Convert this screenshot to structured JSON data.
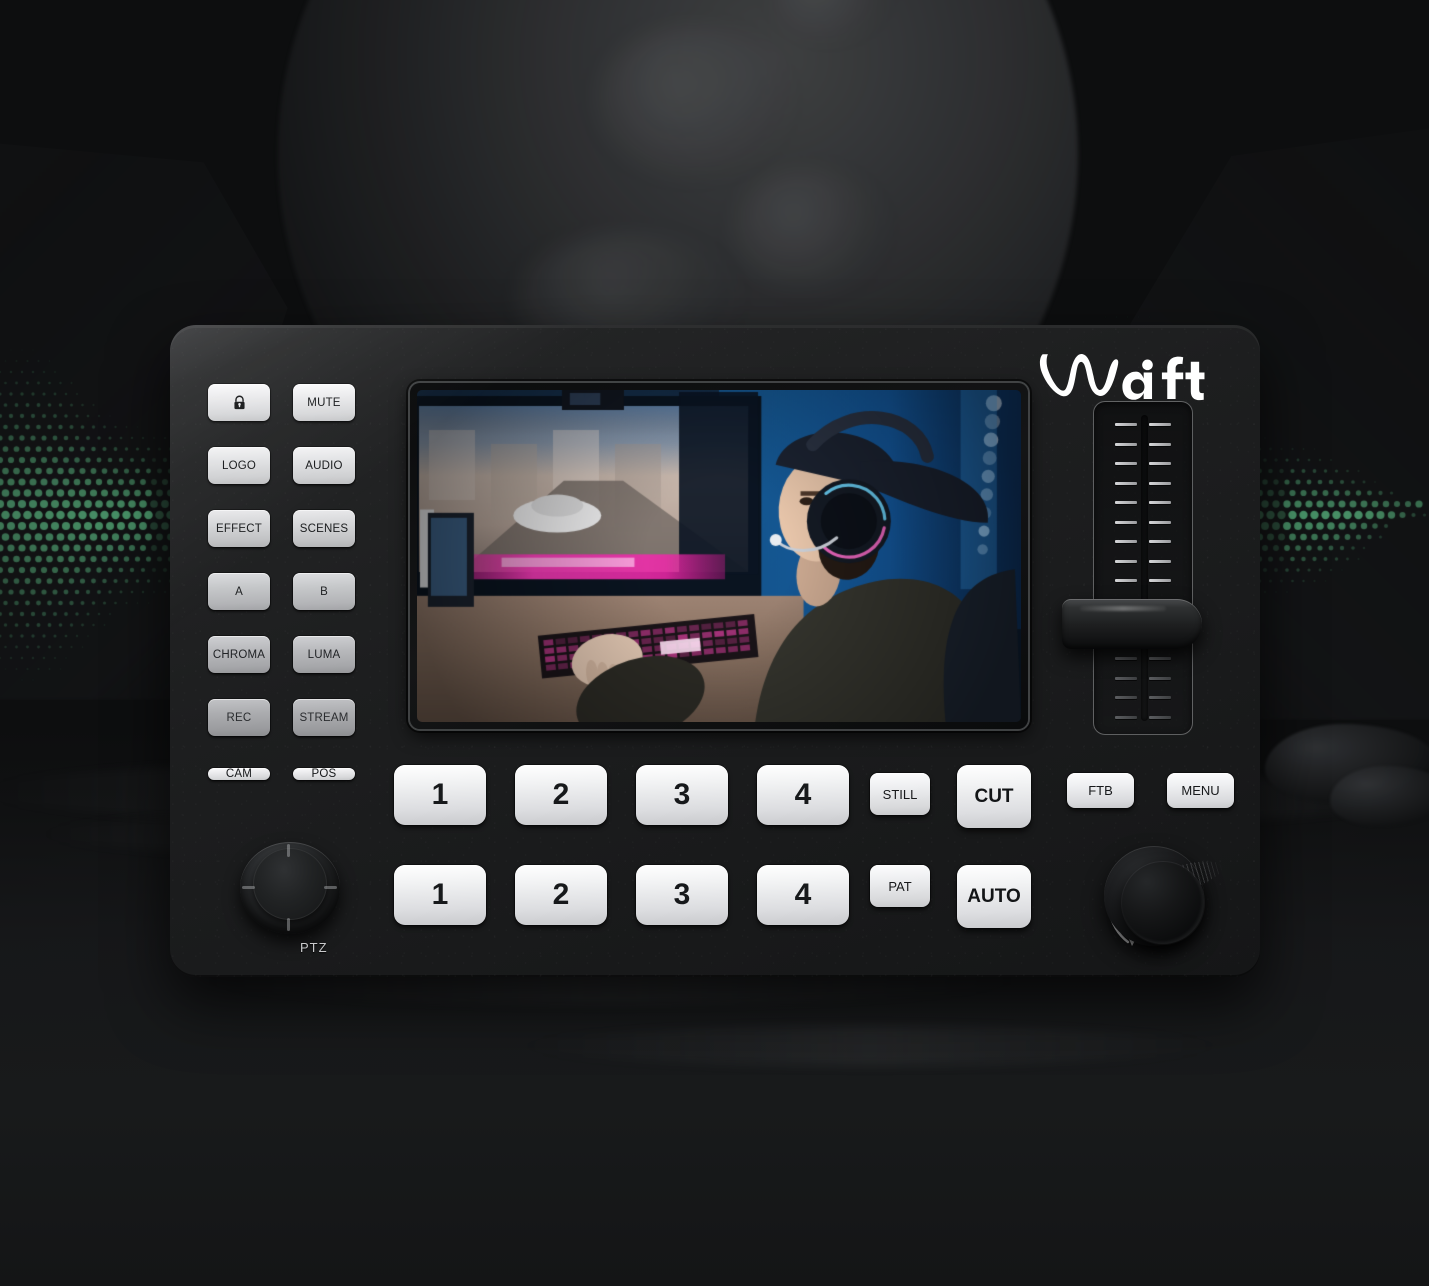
{
  "brand": {
    "name": "Waft"
  },
  "device": {
    "name": "video-switcher-console"
  },
  "side_buttons": {
    "rows": [
      {
        "left": {
          "label": "",
          "icon": "lock-icon",
          "name": "lock-button"
        },
        "right": {
          "label": "MUTE",
          "name": "mute-button"
        }
      },
      {
        "left": {
          "label": "LOGO",
          "name": "logo-button"
        },
        "right": {
          "label": "AUDIO",
          "name": "audio-button"
        }
      },
      {
        "left": {
          "label": "EFFECT",
          "name": "effect-button"
        },
        "right": {
          "label": "SCENES",
          "name": "scenes-button"
        }
      },
      {
        "left": {
          "label": "A",
          "name": "key-a-button"
        },
        "right": {
          "label": "B",
          "name": "key-b-button"
        }
      },
      {
        "left": {
          "label": "CHROMA",
          "name": "chroma-button"
        },
        "right": {
          "label": "LUMA",
          "name": "luma-button"
        }
      },
      {
        "left": {
          "label": "REC",
          "name": "rec-button"
        },
        "right": {
          "label": "STREAM",
          "name": "stream-button"
        }
      }
    ],
    "cam": "CAM",
    "pos": "POS"
  },
  "joystick": {
    "label": "PTZ"
  },
  "program_row": {
    "buttons": [
      "1",
      "2",
      "3",
      "4"
    ]
  },
  "preview_row": {
    "buttons": [
      "1",
      "2",
      "3",
      "4"
    ]
  },
  "transition": {
    "still": "STILL",
    "pat": "PAT",
    "cut": "CUT",
    "auto": "AUTO"
  },
  "utility": {
    "ftb": "FTB",
    "menu": "MENU"
  },
  "tbar": {
    "name": "t-bar-fader",
    "handle_position_percent": 60,
    "tick_count": 16
  },
  "screen": {
    "name": "preview-monitor",
    "content_description": "Gamer wearing cap and headset at desk playing a racing game on monitor"
  },
  "colors": {
    "device_body": "#1d1e1f",
    "button_face": "#ececee",
    "button_text": "#16181a",
    "accent_green": "#6ee7a0",
    "background": "#131415",
    "screen_blue": "#1b4f8f",
    "screen_magenta": "#e61fa0"
  },
  "background": {
    "scene": "moonscape",
    "waveform": "green-halftone-audio-waveform"
  }
}
